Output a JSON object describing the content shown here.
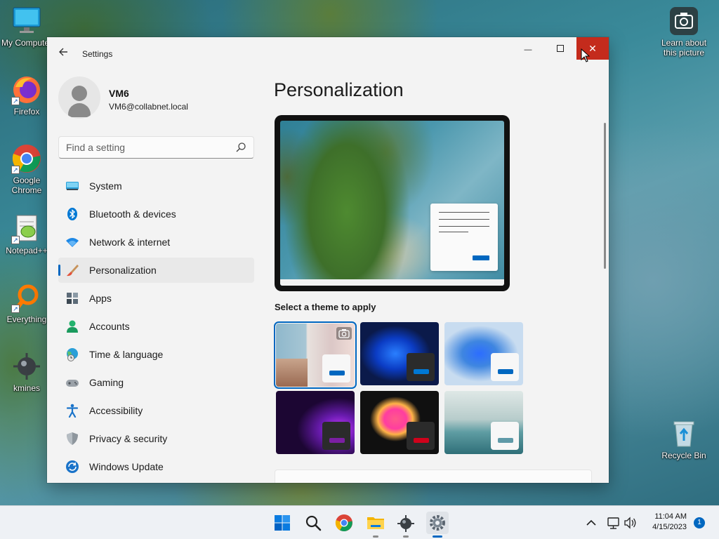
{
  "desktop": {
    "icons": {
      "my_computer": "My Computer",
      "firefox": "Firefox",
      "chrome": "Google Chrome",
      "notepad": "Notepad++",
      "everything": "Everything",
      "kmines": "kmines",
      "learn": "Learn about this picture",
      "recycle": "Recycle Bin"
    }
  },
  "window": {
    "title": "Settings",
    "controls": {
      "minimize": "—",
      "close": "✕"
    }
  },
  "profile": {
    "name": "VM6",
    "email": "VM6@collabnet.local"
  },
  "search": {
    "placeholder": "Find a setting"
  },
  "nav": {
    "items": [
      {
        "label": "System",
        "icon": "system-icon"
      },
      {
        "label": "Bluetooth & devices",
        "icon": "bluetooth-icon"
      },
      {
        "label": "Network & internet",
        "icon": "wifi-icon"
      },
      {
        "label": "Personalization",
        "icon": "brush-icon",
        "selected": true
      },
      {
        "label": "Apps",
        "icon": "apps-icon"
      },
      {
        "label": "Accounts",
        "icon": "accounts-icon"
      },
      {
        "label": "Time & language",
        "icon": "globe-clock-icon"
      },
      {
        "label": "Gaming",
        "icon": "gamepad-icon"
      },
      {
        "label": "Accessibility",
        "icon": "accessibility-icon"
      },
      {
        "label": "Privacy & security",
        "icon": "shield-icon"
      },
      {
        "label": "Windows Update",
        "icon": "update-icon"
      }
    ]
  },
  "main": {
    "title": "Personalization",
    "themes_label": "Select a theme to apply",
    "themes": [
      {
        "id": "spotlight",
        "mini_bg": "#f7f7f7",
        "accent": "#0067c0",
        "selected": true
      },
      {
        "id": "windows-dark",
        "mini_bg": "#2b2b2b",
        "accent": "#0078d4"
      },
      {
        "id": "windows-light",
        "mini_bg": "#f7f7f7",
        "accent": "#0067c0"
      },
      {
        "id": "glow",
        "mini_bg": "#2b2b2b",
        "accent": "#7b1fa2"
      },
      {
        "id": "captured-motion",
        "mini_bg": "#2b2b2b",
        "accent": "#d0021b"
      },
      {
        "id": "flow",
        "mini_bg": "#f7f7f7",
        "accent": "#5f9aa8"
      }
    ]
  },
  "taskbar": {
    "time": "11:04 AM",
    "date": "4/15/2023",
    "notifications": "1"
  },
  "colors": {
    "accent": "#0067c0",
    "close_red": "#c42b1c"
  }
}
